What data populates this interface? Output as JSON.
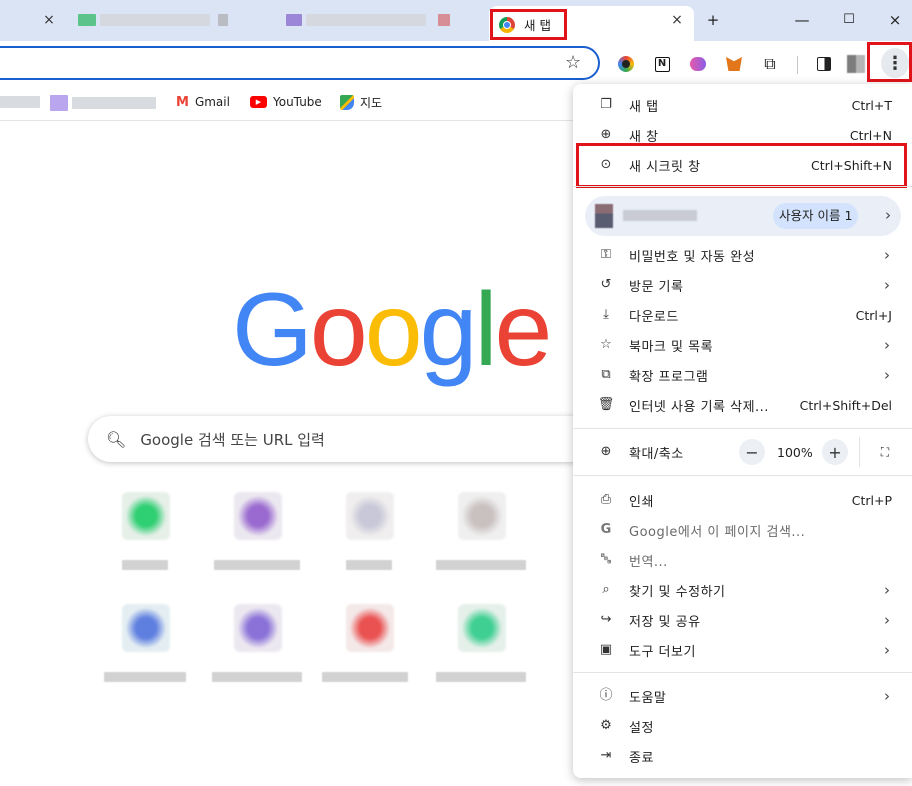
{
  "tabs": {
    "active_title": "새 탭",
    "close_glyph": "×",
    "new_tab_glyph": "+"
  },
  "window_controls": {
    "minimize": "—",
    "maximize": "☐",
    "close": "×"
  },
  "toolbar": {
    "star": "☆",
    "menu_glyph": "⋮"
  },
  "bookmarks": [
    {
      "label": "Gmail",
      "icon": "gmail-icon"
    },
    {
      "label": "YouTube",
      "icon": "youtube-icon"
    },
    {
      "label": "지도",
      "icon": "maps-icon"
    }
  ],
  "ntp": {
    "search_placeholder": "Google 검색 또는 URL 입력",
    "logo_letters": [
      "G",
      "o",
      "o",
      "g",
      "l",
      "e"
    ]
  },
  "menu": {
    "new_tab": {
      "label": "새 탭",
      "shortcut": "Ctrl+T"
    },
    "new_window": {
      "label": "새 창",
      "shortcut": "Ctrl+N"
    },
    "incognito": {
      "label": "새 시크릿 창",
      "shortcut": "Ctrl+Shift+N"
    },
    "profile_badge": "사용자 이름 1",
    "passwords": {
      "label": "비밀번호 및 자동 완성"
    },
    "history": {
      "label": "방문 기록"
    },
    "downloads": {
      "label": "다운로드",
      "shortcut": "Ctrl+J"
    },
    "bookmarks": {
      "label": "북마크 및 목록"
    },
    "extensions": {
      "label": "확장 프로그램"
    },
    "clear_data": {
      "label": "인터넷 사용 기록 삭제...",
      "shortcut": "Ctrl+Shift+Del"
    },
    "zoom": {
      "label": "확대/축소",
      "value": "100%",
      "minus": "−",
      "plus": "+"
    },
    "print": {
      "label": "인쇄",
      "shortcut": "Ctrl+P"
    },
    "search_page": {
      "label": "Google에서 이 페이지 검색..."
    },
    "translate": {
      "label": "번역..."
    },
    "find_edit": {
      "label": "찾기 및 수정하기"
    },
    "save_share": {
      "label": "저장 및 공유"
    },
    "more_tools": {
      "label": "도구 더보기"
    },
    "help": {
      "label": "도움말"
    },
    "settings": {
      "label": "설정"
    },
    "exit": {
      "label": "종료"
    }
  },
  "colors": {
    "highlight_box": "#e0131a",
    "tabstrip_bg": "#dbe4f5",
    "omnibox_border": "#1a5fd0"
  }
}
